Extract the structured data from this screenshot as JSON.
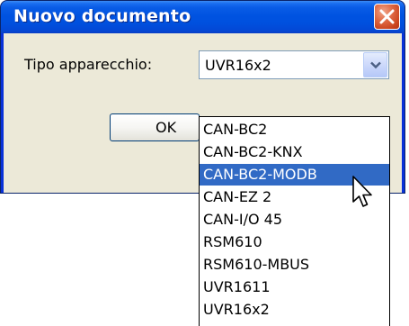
{
  "dialog": {
    "title": "Nuovo documento",
    "close_icon": "close-icon"
  },
  "form": {
    "device_type_label": "Tipo apparecchio:",
    "device_type_value": "UVR16x2",
    "dropdown_icon": "chevron-down-icon"
  },
  "buttons": {
    "ok_label": "OK"
  },
  "dropdown": {
    "options": [
      "CAN-BC2",
      "CAN-BC2-KNX",
      "CAN-BC2-MODB",
      "CAN-EZ 2",
      "CAN-I/O 45",
      "RSM610",
      "RSM610-MBUS",
      "UVR1611",
      "UVR16x2"
    ],
    "highlighted": "CAN-BC2-MODB"
  },
  "colors": {
    "titlebar": "#0053e1",
    "close_button": "#c8411b",
    "client_area": "#ece9d8",
    "selection": "#316ac5"
  },
  "pointer_icon": "arrow-pointer-icon"
}
